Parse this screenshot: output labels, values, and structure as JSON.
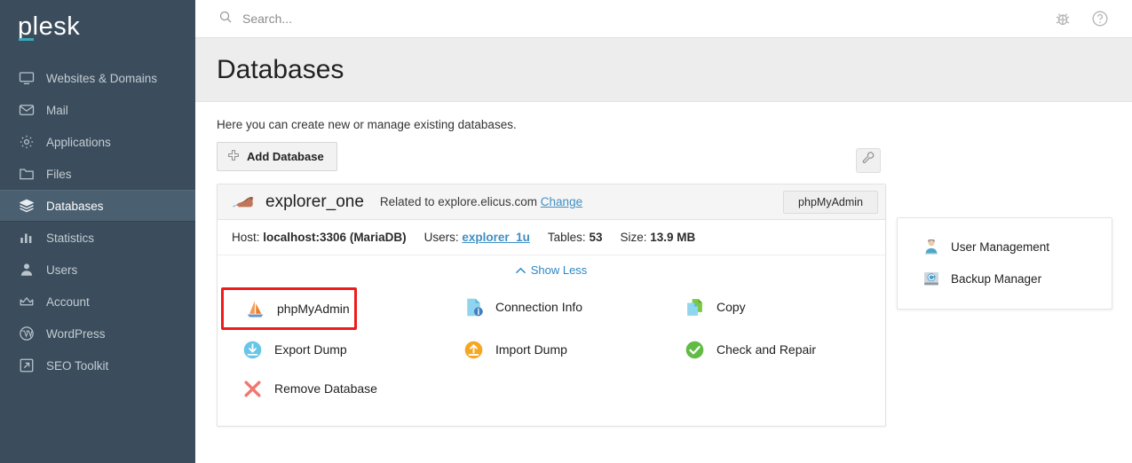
{
  "brand": {
    "name": "plesk",
    "accent": "#3ba9b8"
  },
  "search": {
    "placeholder": "Search...",
    "value": ""
  },
  "topbar": {
    "icons": [
      {
        "name": "bug-icon",
        "label": "Bug"
      },
      {
        "name": "help-icon",
        "label": "Help"
      }
    ]
  },
  "sidebar": {
    "items": [
      {
        "label": "Websites & Domains",
        "icon": "monitor-icon",
        "active": false
      },
      {
        "label": "Mail",
        "icon": "envelope-icon",
        "active": false
      },
      {
        "label": "Applications",
        "icon": "gear-icon",
        "active": false
      },
      {
        "label": "Files",
        "icon": "folder-icon",
        "active": false
      },
      {
        "label": "Databases",
        "icon": "database-layers-icon",
        "active": true
      },
      {
        "label": "Statistics",
        "icon": "bar-chart-icon",
        "active": false
      },
      {
        "label": "Users",
        "icon": "person-icon",
        "active": false
      },
      {
        "label": "Account",
        "icon": "crown-icon",
        "active": false
      },
      {
        "label": "WordPress",
        "icon": "wordpress-icon",
        "active": false
      },
      {
        "label": "SEO Toolkit",
        "icon": "arrow-trend-icon",
        "active": false
      }
    ]
  },
  "page": {
    "title": "Databases",
    "description": "Here you can create new or manage existing databases.",
    "add_database_label": "Add Database",
    "tool_button": "wrench-icon"
  },
  "database": {
    "name": "explorer_one",
    "related_prefix": "Related to",
    "related_domain": "explore.elicus.com",
    "change_link": "Change",
    "phpmyadmin_button": "phpMyAdmin",
    "seal_icon": "mariadb-seal-icon",
    "meta": [
      {
        "label": "Host:",
        "value": "localhost:3306 (MariaDB)",
        "link": false
      },
      {
        "label": "Users:",
        "value": "explorer_1u",
        "link": true
      },
      {
        "label": "Tables:",
        "value": "53",
        "link": false
      },
      {
        "label": "Size:",
        "value": "13.9 MB",
        "link": false
      }
    ],
    "show_less_label": "Show Less",
    "actions": [
      {
        "label": "phpMyAdmin",
        "icon": "phpmyadmin-sailboat-icon",
        "highlight": true
      },
      {
        "label": "Connection Info",
        "icon": "connection-info-icon",
        "highlight": false
      },
      {
        "label": "Copy",
        "icon": "copy-documents-icon",
        "highlight": false
      },
      {
        "label": "Export Dump",
        "icon": "export-download-icon",
        "highlight": false
      },
      {
        "label": "Import Dump",
        "icon": "import-upload-icon",
        "highlight": false
      },
      {
        "label": "Check and Repair",
        "icon": "check-circle-icon",
        "highlight": false
      },
      {
        "label": "Remove Database",
        "icon": "remove-x-icon",
        "highlight": false
      }
    ]
  },
  "right_panel": {
    "items": [
      {
        "label": "User Management",
        "icon": "user-management-icon"
      },
      {
        "label": "Backup Manager",
        "icon": "backup-manager-icon"
      }
    ]
  }
}
